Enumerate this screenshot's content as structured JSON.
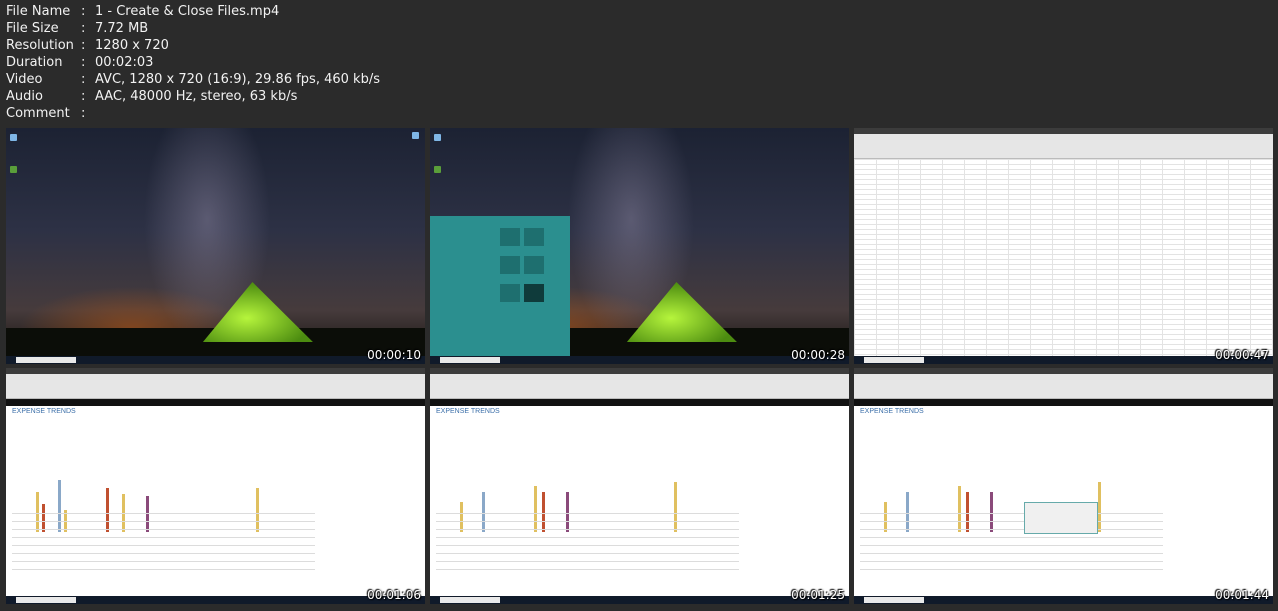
{
  "info": [
    {
      "key": "File Name",
      "value": "1 - Create & Close Files.mp4"
    },
    {
      "key": "File Size",
      "value": "7.72 MB"
    },
    {
      "key": "Resolution",
      "value": "1280 x 720"
    },
    {
      "key": "Duration",
      "value": "00:02:03"
    },
    {
      "key": "Video",
      "value": "AVC, 1280 x 720 (16:9), 29.86 fps, 460 kb/s"
    },
    {
      "key": "Audio",
      "value": "AAC, 48000 Hz, stereo, 63 kb/s"
    },
    {
      "key": "Comment",
      "value": ""
    }
  ],
  "separator": ":",
  "thumbnails": [
    {
      "timestamp": "00:00:10",
      "scene": "desktop"
    },
    {
      "timestamp": "00:00:28",
      "scene": "desktop-start-menu"
    },
    {
      "timestamp": "00:00:47",
      "scene": "excel-blank-workbook"
    },
    {
      "timestamp": "00:01:06",
      "scene": "excel-expense-trends"
    },
    {
      "timestamp": "00:01:25",
      "scene": "excel-expense-trends"
    },
    {
      "timestamp": "00:01:44",
      "scene": "excel-expense-trends-save-dialog"
    }
  ],
  "report_title": "EXPENSE TRENDS",
  "colors": {
    "background": "#2b2b2b",
    "text": "#f2f2f2",
    "tent": "#8fd62a",
    "start_menu": "#2b8f8f"
  }
}
